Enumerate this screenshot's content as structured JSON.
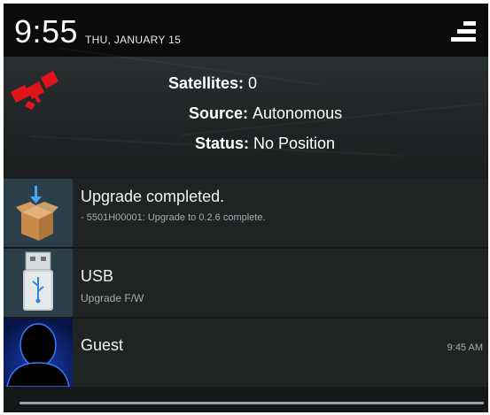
{
  "status_bar": {
    "time": "9:55",
    "date": "THU, JANUARY 15",
    "settings_icon": "quick-settings-icon"
  },
  "gps": {
    "icon": "satellite-icon",
    "satellites_label": "Satellites:",
    "satellites_value": "0",
    "source_label": "Source:",
    "source_value": "Autonomous",
    "status_label": "Status:",
    "status_value": "No Position"
  },
  "notifications": [
    {
      "icon": "package-download-icon",
      "title": "Upgrade completed.",
      "text": "- 5501H00001: Upgrade to 0.2.6 complete.",
      "time": ""
    },
    {
      "icon": "usb-icon",
      "title": "USB",
      "text": "Upgrade F/W",
      "time": ""
    },
    {
      "icon": "guest-avatar-icon",
      "title": "Guest",
      "text": "",
      "time": "9:45 AM"
    }
  ],
  "colors": {
    "background": "#151819",
    "notification_bg": "#202324",
    "satellite_red": "#e0141a",
    "usb_blue": "#2f86d8"
  }
}
